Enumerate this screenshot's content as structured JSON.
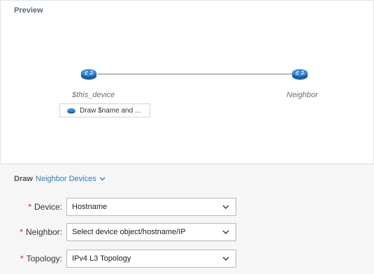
{
  "preview": {
    "title": "Preview",
    "source_node_label": "$this_device",
    "target_node_label": "Neighbor",
    "draw_chip_label": "Draw $name and ..."
  },
  "icons": {
    "router": "router-icon",
    "chip": "router-icon",
    "dropdown": "chevron-down-icon"
  },
  "colors": {
    "router_fill": "#2f7cc6",
    "link": "#2e7bbf",
    "required": "#d0241b"
  },
  "draw": {
    "label": "Draw",
    "mode": "Neighbor Devices"
  },
  "form": {
    "device": {
      "label": "Device:",
      "value": "Hostname"
    },
    "neighbor": {
      "label": "Neighbor:",
      "value": "Select device object/hostname/IP"
    },
    "topology": {
      "label": "Topology:",
      "value": "IPv4 L3 Topology"
    }
  }
}
